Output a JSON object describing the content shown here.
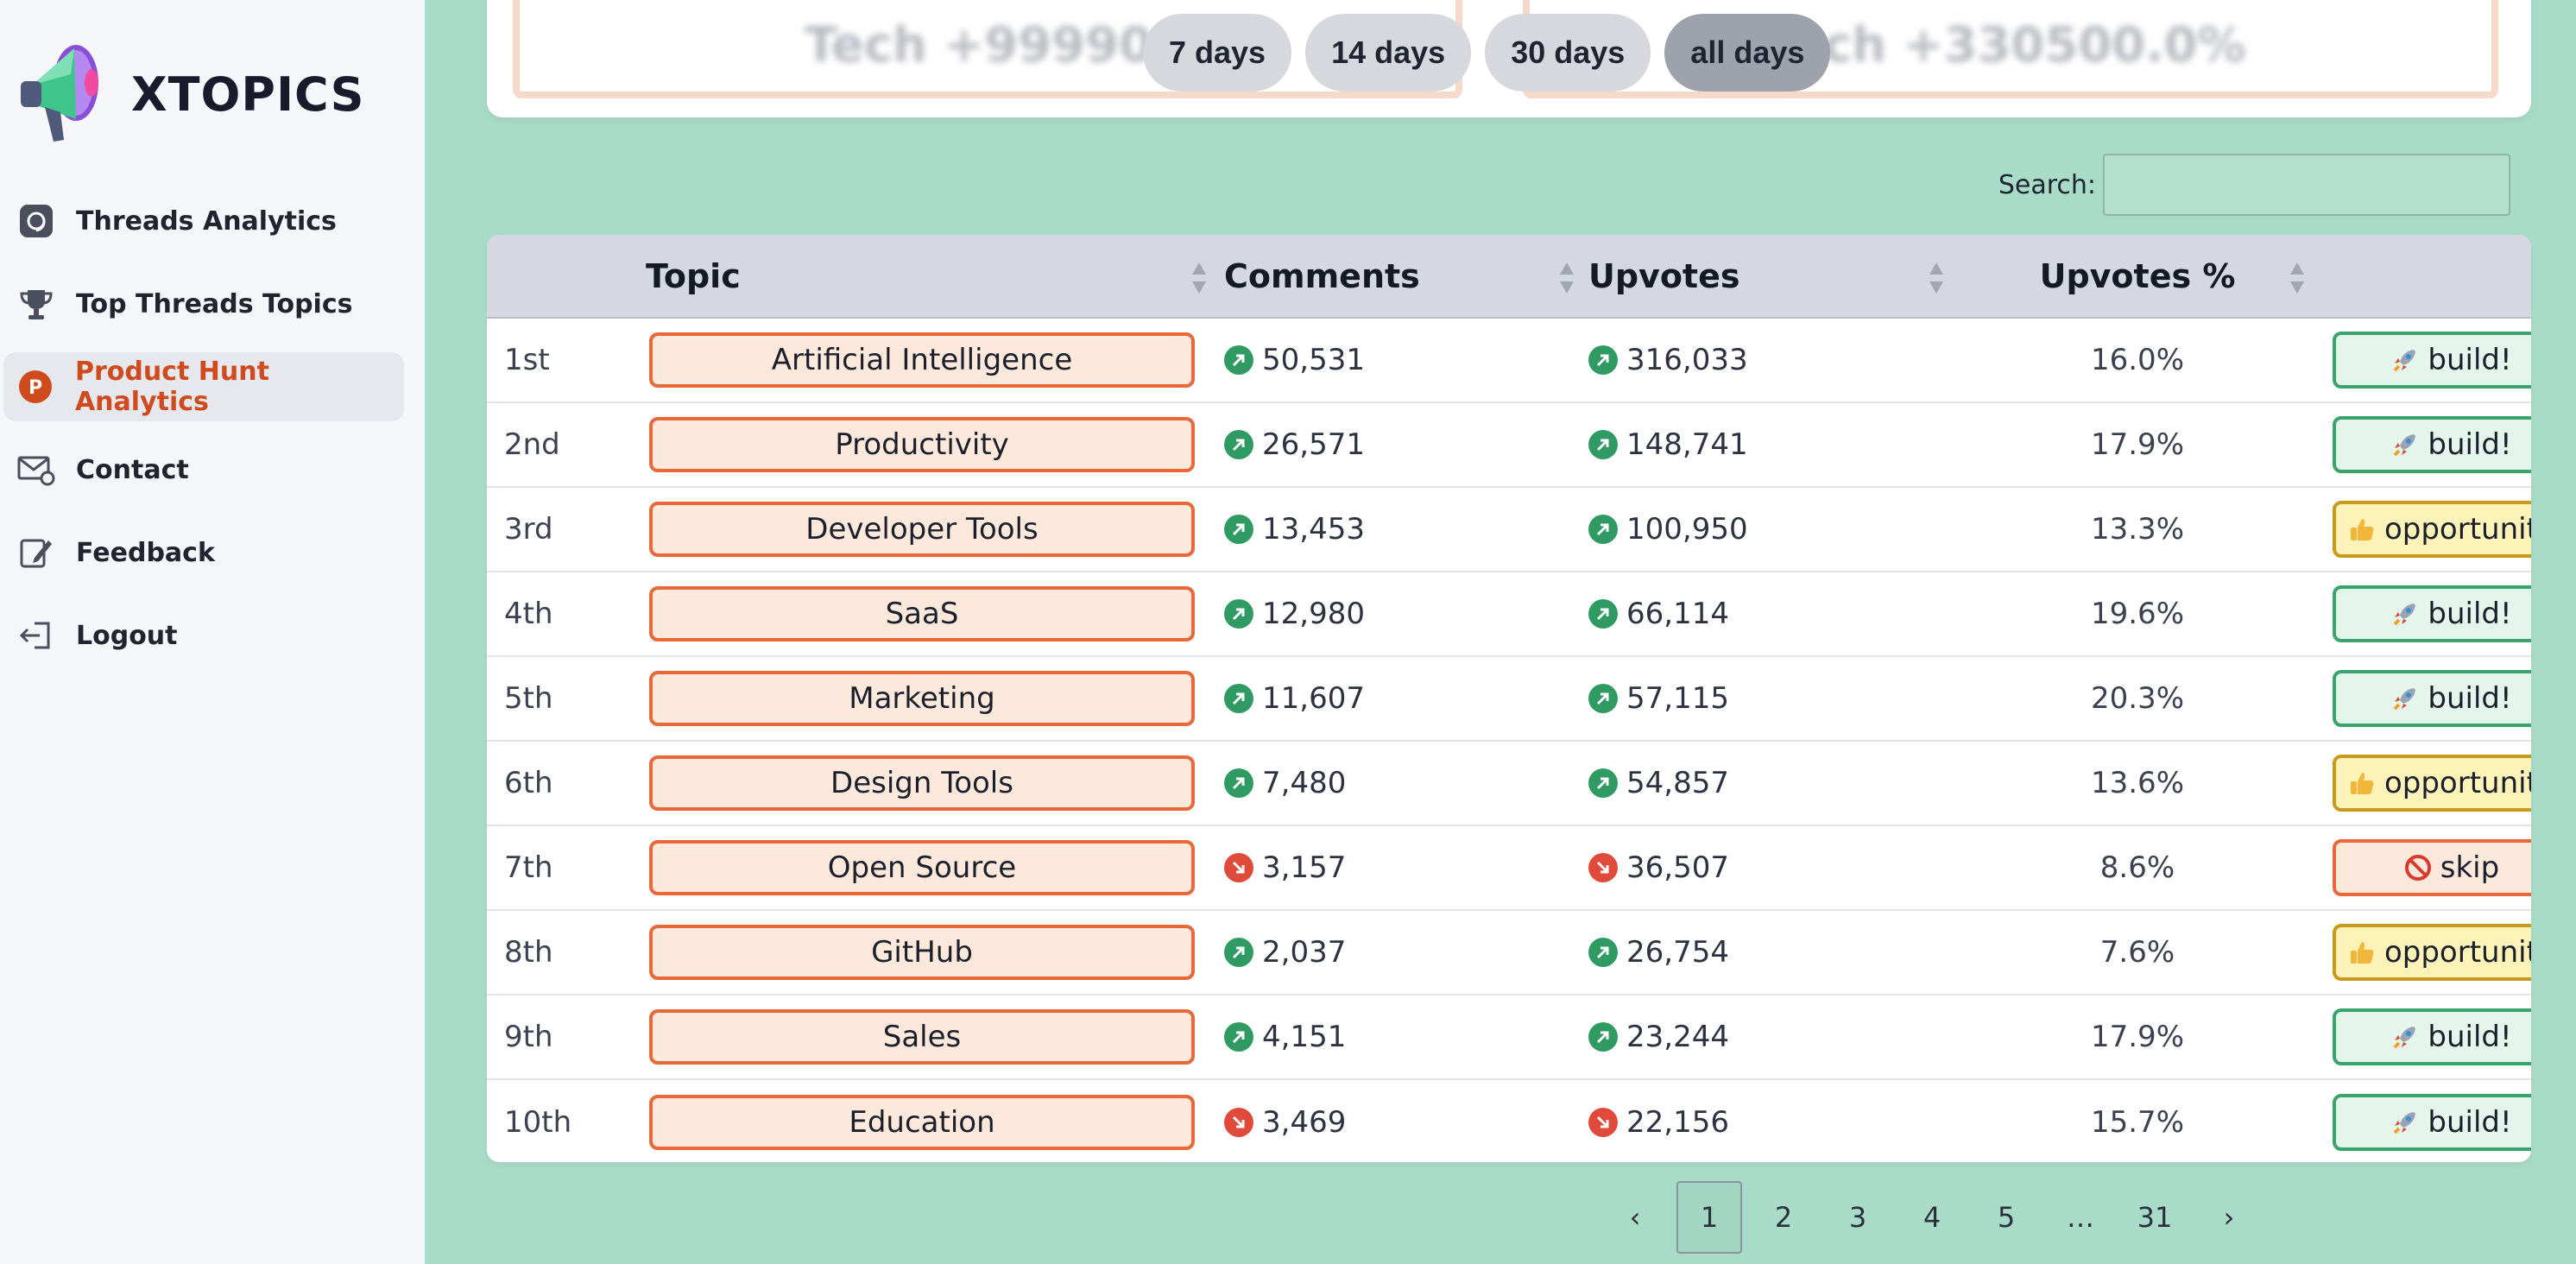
{
  "app": {
    "name": "XTOPICS"
  },
  "colors": {
    "accent": "#cf4a1c",
    "up": "#2f9a62",
    "down": "#e04a3a",
    "background": "#a9dcc8"
  },
  "sidebar": {
    "items": [
      {
        "label": "Threads Analytics",
        "icon": "threads-icon",
        "active": false
      },
      {
        "label": "Top Threads Topics",
        "icon": "trophy-icon",
        "active": false
      },
      {
        "label": "Product Hunt Analytics",
        "icon": "product-hunt-icon",
        "active": true
      },
      {
        "label": "Contact",
        "icon": "mail-icon",
        "active": false
      },
      {
        "label": "Feedback",
        "icon": "edit-icon",
        "active": false
      },
      {
        "label": "Logout",
        "icon": "logout-icon",
        "active": false
      }
    ]
  },
  "top_panels": {
    "left_text": "Tech +99990.9",
    "right_text": "ch +330500.0%"
  },
  "ranges": [
    "7 days",
    "14 days",
    "30 days",
    "all days"
  ],
  "active_range": "all days",
  "search": {
    "label": "Search:",
    "value": ""
  },
  "table": {
    "headers": [
      "",
      "Topic",
      "Comments",
      "Upvotes",
      "Upvotes %",
      ""
    ],
    "rows": [
      {
        "rank": "1st",
        "topic": "Artificial Intelligence",
        "comments": "50,531",
        "comments_trend": "up",
        "upvotes": "316,033",
        "upvotes_trend": "up",
        "pct": "16.0%",
        "badge": "build!",
        "badge_type": "build"
      },
      {
        "rank": "2nd",
        "topic": "Productivity",
        "comments": "26,571",
        "comments_trend": "up",
        "upvotes": "148,741",
        "upvotes_trend": "up",
        "pct": "17.9%",
        "badge": "build!",
        "badge_type": "build"
      },
      {
        "rank": "3rd",
        "topic": "Developer Tools",
        "comments": "13,453",
        "comments_trend": "up",
        "upvotes": "100,950",
        "upvotes_trend": "up",
        "pct": "13.3%",
        "badge": "opportunity",
        "badge_type": "opportunity"
      },
      {
        "rank": "4th",
        "topic": "SaaS",
        "comments": "12,980",
        "comments_trend": "up",
        "upvotes": "66,114",
        "upvotes_trend": "up",
        "pct": "19.6%",
        "badge": "build!",
        "badge_type": "build"
      },
      {
        "rank": "5th",
        "topic": "Marketing",
        "comments": "11,607",
        "comments_trend": "up",
        "upvotes": "57,115",
        "upvotes_trend": "up",
        "pct": "20.3%",
        "badge": "build!",
        "badge_type": "build"
      },
      {
        "rank": "6th",
        "topic": "Design Tools",
        "comments": "7,480",
        "comments_trend": "up",
        "upvotes": "54,857",
        "upvotes_trend": "up",
        "pct": "13.6%",
        "badge": "opportunity",
        "badge_type": "opportunity"
      },
      {
        "rank": "7th",
        "topic": "Open Source",
        "comments": "3,157",
        "comments_trend": "down",
        "upvotes": "36,507",
        "upvotes_trend": "down",
        "pct": "8.6%",
        "badge": "skip",
        "badge_type": "skip"
      },
      {
        "rank": "8th",
        "topic": "GitHub",
        "comments": "2,037",
        "comments_trend": "up",
        "upvotes": "26,754",
        "upvotes_trend": "up",
        "pct": "7.6%",
        "badge": "opportunity",
        "badge_type": "opportunity"
      },
      {
        "rank": "9th",
        "topic": "Sales",
        "comments": "4,151",
        "comments_trend": "up",
        "upvotes": "23,244",
        "upvotes_trend": "up",
        "pct": "17.9%",
        "badge": "build!",
        "badge_type": "build"
      },
      {
        "rank": "10th",
        "topic": "Education",
        "comments": "3,469",
        "comments_trend": "down",
        "upvotes": "22,156",
        "upvotes_trend": "down",
        "pct": "15.7%",
        "badge": "build!",
        "badge_type": "build"
      }
    ]
  },
  "pagination": {
    "prev": "‹",
    "pages": [
      "1",
      "2",
      "3",
      "4",
      "5",
      "…",
      "31"
    ],
    "current": "1",
    "next": "›"
  }
}
